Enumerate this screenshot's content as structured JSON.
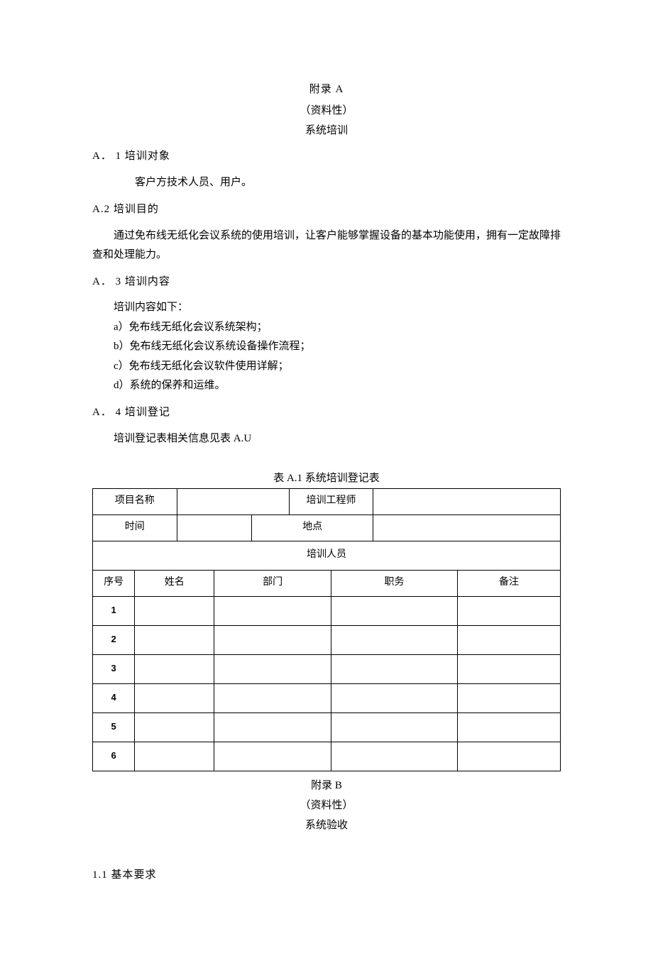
{
  "appendixA": {
    "title": "附录 A",
    "type": "（资料性）",
    "subject": "系统培训"
  },
  "a1": {
    "heading": "A．  1 培训对象",
    "body": "客户方技术人员、用户。"
  },
  "a2": {
    "heading": "A.2 培训目的",
    "body": "通过免布线无纸化会议系统的使用培训，让客户能够掌握设备的基本功能使用，拥有一定故障排查和处理能力。"
  },
  "a3": {
    "heading": "A．  3 培训内容",
    "intro": "培训内容如下：",
    "items": [
      "a）免布线无纸化会议系统架构；",
      "b）免布线无纸化会议系统设备操作流程；",
      "c）免布线无纸化会议软件使用详解；",
      "d）系统的保养和运维。"
    ]
  },
  "a4": {
    "heading": "A．  4 培训登记",
    "body": "培训登记表相关信息见表 A.U"
  },
  "table": {
    "caption": "表 A.1 系统培训登记表",
    "row1": {
      "projectLabel": "项目名称",
      "trainerLabel": "培训工程师"
    },
    "row2": {
      "timeLabel": "时间",
      "placeLabel": "地点"
    },
    "row3": {
      "traineesLabel": "培训人员"
    },
    "headers": {
      "no": "序号",
      "name": "姓名",
      "dept": "部门",
      "role": "职务",
      "remark": "备注"
    },
    "rows": [
      "1",
      "2",
      "3",
      "4",
      "5",
      "6"
    ]
  },
  "appendixB": {
    "title": "附录 B",
    "type": "（资料性）",
    "subject": "系统验收"
  },
  "b1": {
    "heading": "1.1  基本要求"
  }
}
